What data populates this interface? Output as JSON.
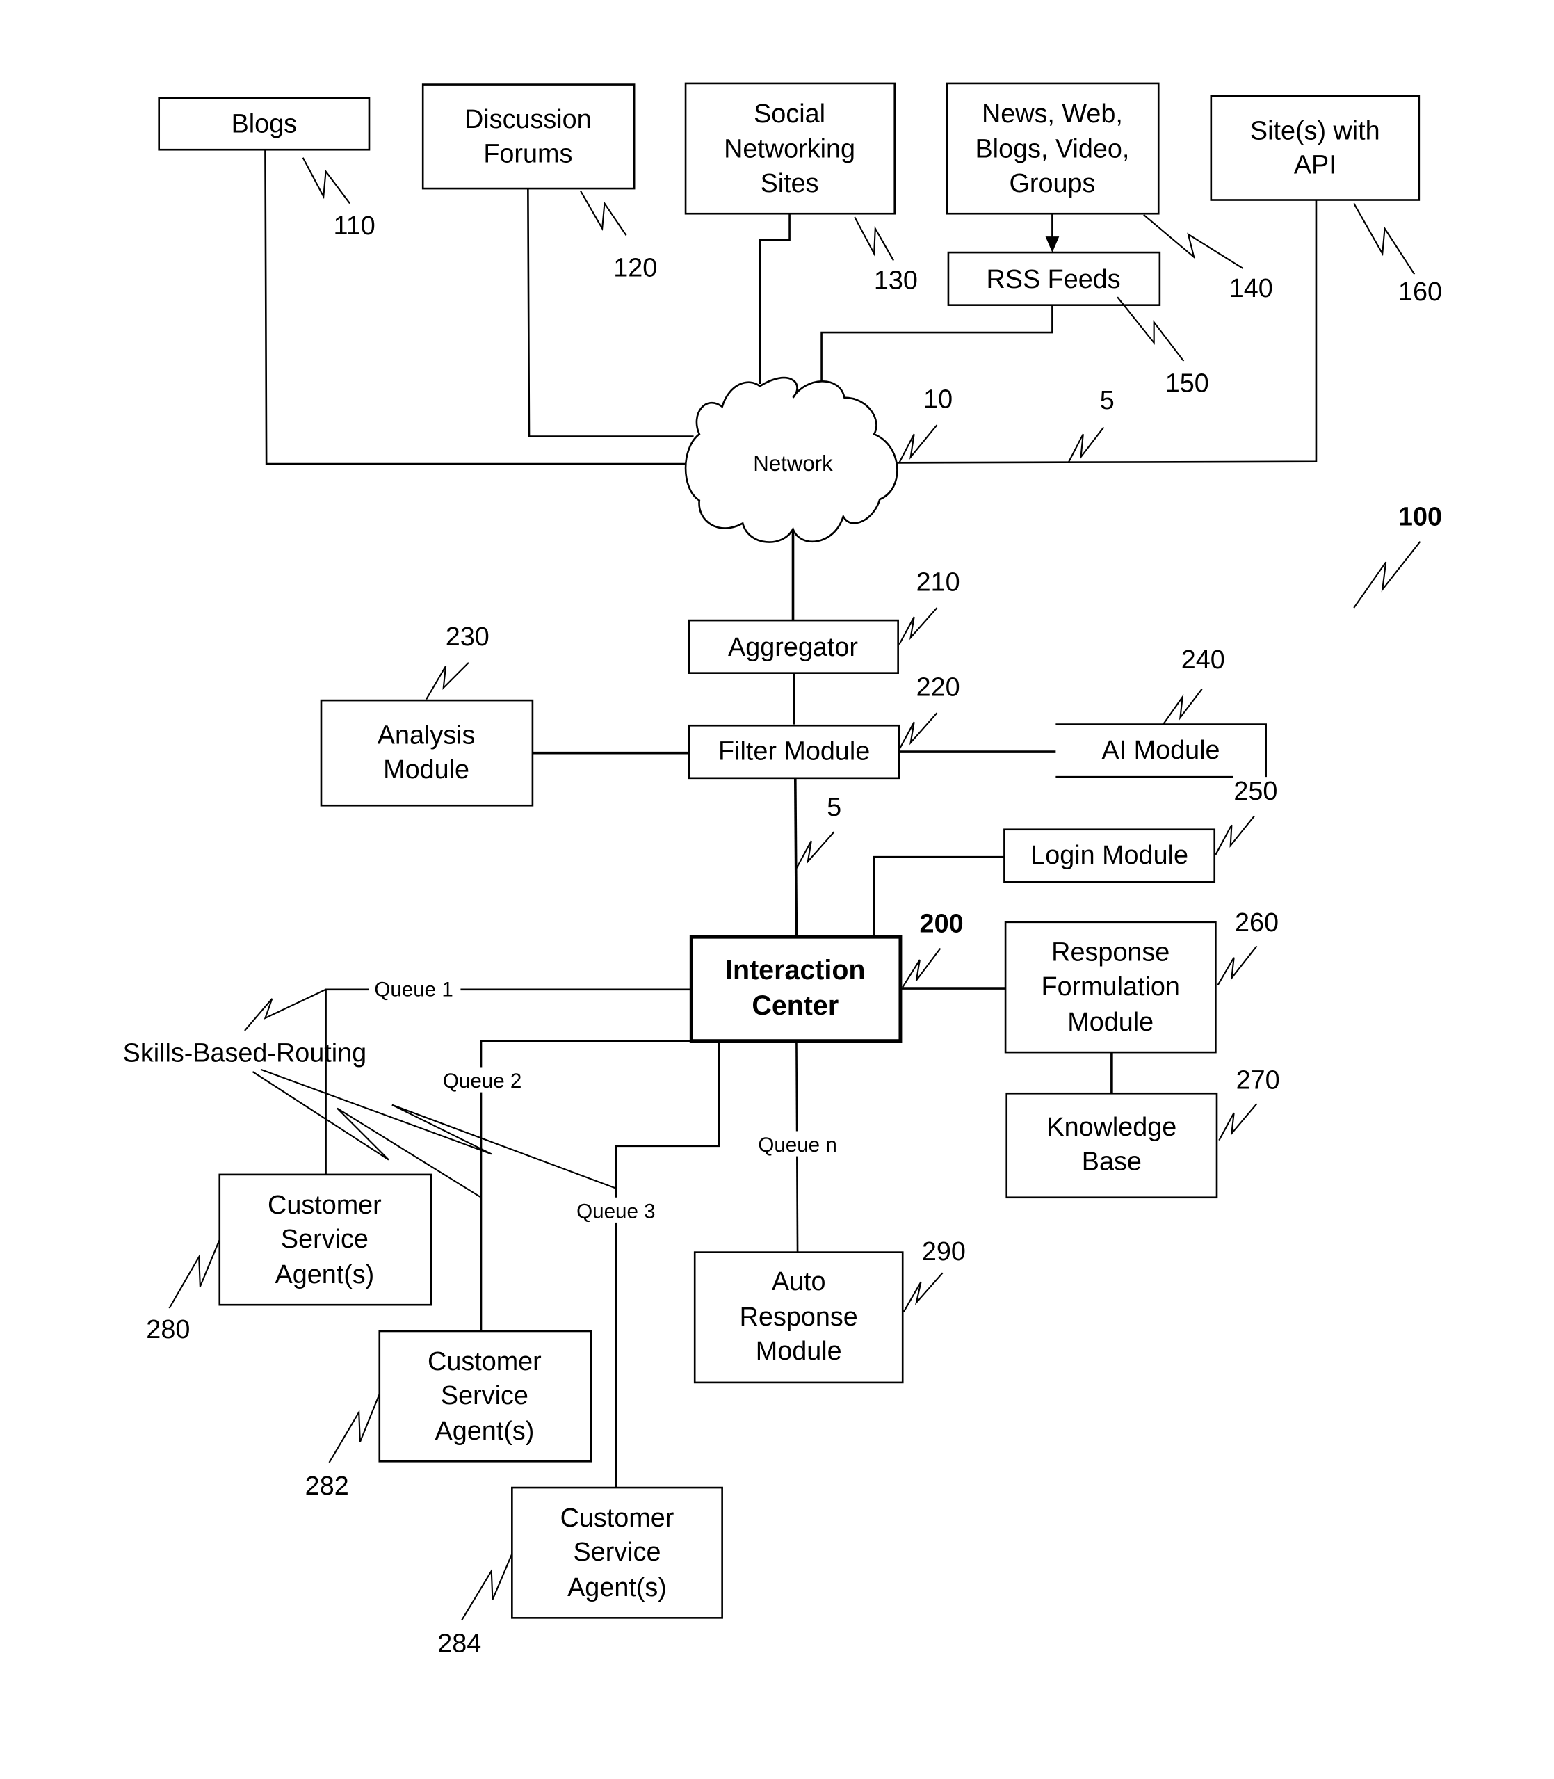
{
  "figure": {
    "reference": "100",
    "sources": [
      {
        "id": "blogs",
        "lines": [
          "Blogs"
        ],
        "ref": "110"
      },
      {
        "id": "discussion-forums",
        "lines": [
          "Discussion",
          "Forums"
        ],
        "ref": "120"
      },
      {
        "id": "social-networking-sites",
        "lines": [
          "Social",
          "Networking",
          "Sites"
        ],
        "ref": "130"
      },
      {
        "id": "news-web",
        "lines": [
          "News, Web,",
          "Blogs, Video,",
          "Groups"
        ],
        "ref": "140"
      },
      {
        "id": "rss-feeds",
        "lines": [
          "RSS Feeds"
        ],
        "ref": "150"
      },
      {
        "id": "sites-with-api",
        "lines": [
          "Site(s) with",
          "API"
        ],
        "ref": "160"
      }
    ],
    "network": {
      "label": "Network",
      "ref": "10",
      "link_ref": "5"
    },
    "modules": [
      {
        "id": "aggregator",
        "lines": [
          "Aggregator"
        ],
        "ref": "210"
      },
      {
        "id": "filter-module",
        "lines": [
          "Filter Module"
        ],
        "ref": "220"
      },
      {
        "id": "analysis-module",
        "lines": [
          "Analysis",
          "Module"
        ],
        "ref": "230"
      },
      {
        "id": "ai-module",
        "lines": [
          "AI Module"
        ],
        "ref": "240"
      },
      {
        "id": "login-module",
        "lines": [
          "Login Module"
        ],
        "ref": "250"
      },
      {
        "id": "response-formulation-module",
        "lines": [
          "Response",
          "Formulation",
          "Module"
        ],
        "ref": "260"
      },
      {
        "id": "knowledge-base",
        "lines": [
          "Knowledge",
          "Base"
        ],
        "ref": "270"
      },
      {
        "id": "auto-response-module",
        "lines": [
          "Auto",
          "Response",
          "Module"
        ],
        "ref": "290"
      }
    ],
    "interaction_center": {
      "lines": [
        "Interaction",
        "Center"
      ],
      "ref": "200",
      "link_ref": "5"
    },
    "agents": [
      {
        "id": "agents-280",
        "lines": [
          "Customer",
          "Service",
          "Agent(s)"
        ],
        "ref": "280"
      },
      {
        "id": "agents-282",
        "lines": [
          "Customer",
          "Service",
          "Agent(s)"
        ],
        "ref": "282"
      },
      {
        "id": "agents-284",
        "lines": [
          "Customer",
          "Service",
          "Agent(s)"
        ],
        "ref": "284"
      }
    ],
    "queues": [
      "Queue 1",
      "Queue 2",
      "Queue 3",
      "Queue n"
    ],
    "routing_label": "Skills-Based-Routing"
  }
}
